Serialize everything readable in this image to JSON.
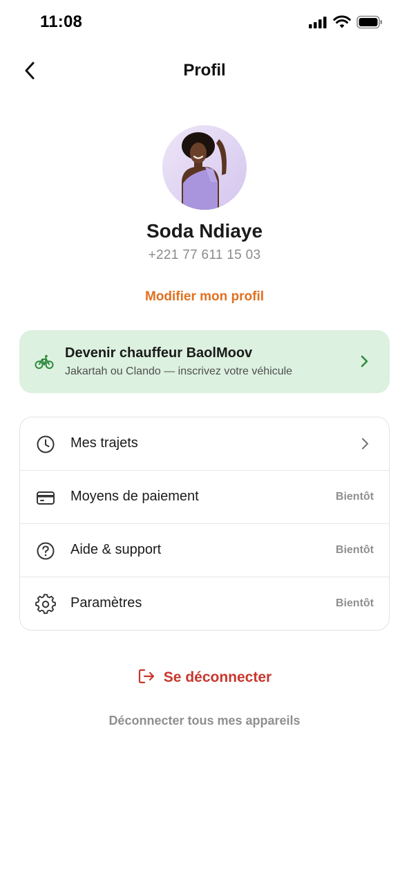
{
  "status_bar": {
    "time": "11:08",
    "icons": [
      "signal-icon",
      "wifi-icon",
      "battery-icon"
    ]
  },
  "header": {
    "title": "Profil",
    "back_icon": "chevron-left-icon"
  },
  "profile": {
    "name": "Soda Ndiaye",
    "phone": "+221 77 611 15 03",
    "edit_label": "Modifier mon profil",
    "avatar_icon": "avatar-photo"
  },
  "driver_banner": {
    "title": "Devenir chauffeur BaolMoov",
    "subtitle": "Jakartah ou Clando — inscrivez votre véhicule",
    "icon": "bicycle-icon",
    "accent": "#2e8b3d",
    "background": "#dcf1df"
  },
  "menu": {
    "items": [
      {
        "label": "Mes trajets",
        "icon": "clock-icon",
        "badge": ""
      },
      {
        "label": "Moyens de paiement",
        "icon": "credit-card-icon",
        "badge": "Bientôt"
      },
      {
        "label": "Aide & support",
        "icon": "help-circle-icon",
        "badge": "Bientôt"
      },
      {
        "label": "Paramètres",
        "icon": "gear-icon",
        "badge": "Bientôt"
      }
    ]
  },
  "actions": {
    "logout_label": "Se déconnecter",
    "logout_all_label": "Déconnecter tous mes appareils"
  },
  "colors": {
    "accent_orange": "#e07020",
    "danger_red": "#c8372d",
    "muted_gray": "#8f8f8f"
  }
}
